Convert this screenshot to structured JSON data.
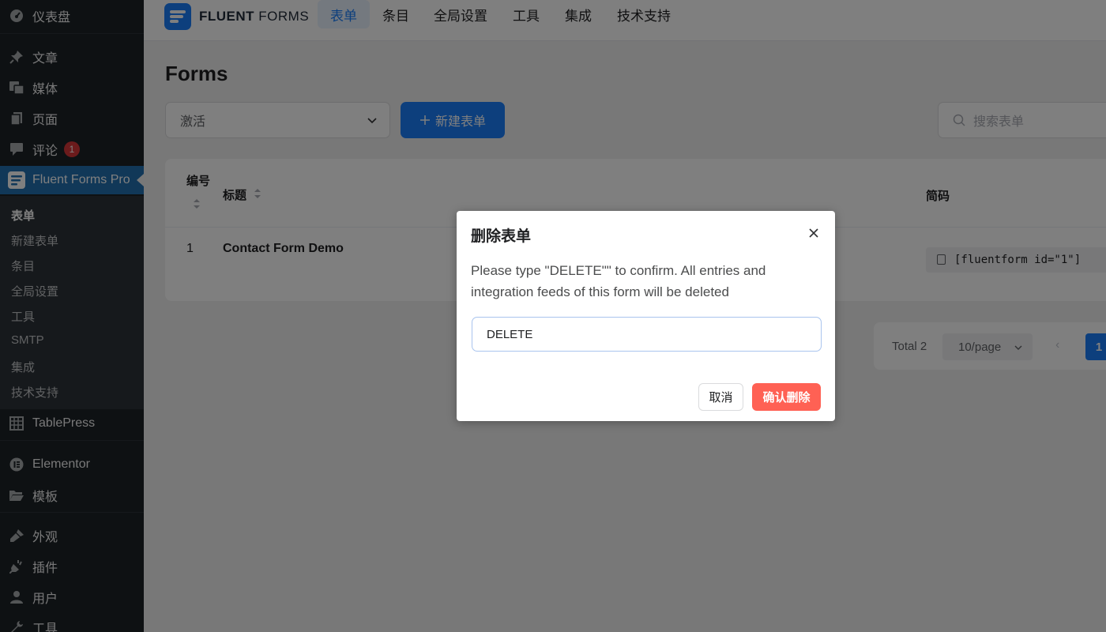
{
  "sidebar": {
    "items": [
      {
        "label": "仪表盘",
        "icon": "dashboard-icon"
      },
      {
        "label": "文章",
        "icon": "pin-icon"
      },
      {
        "label": "媒体",
        "icon": "media-icon"
      },
      {
        "label": "页面",
        "icon": "page-icon"
      },
      {
        "label": "评论",
        "icon": "comment-icon",
        "badge": "1"
      },
      {
        "label": "Fluent Forms Pro",
        "icon": "fluent-forms-icon"
      },
      {
        "label": "TablePress",
        "icon": "table-icon"
      },
      {
        "label": "Elementor",
        "icon": "elementor-icon"
      },
      {
        "label": "模板",
        "icon": "folder-icon"
      },
      {
        "label": "外观",
        "icon": "brush-icon"
      },
      {
        "label": "插件",
        "icon": "plugin-icon"
      },
      {
        "label": "用户",
        "icon": "user-icon"
      },
      {
        "label": "工具",
        "icon": "wrench-icon"
      }
    ],
    "submenu": [
      "表单",
      "新建表单",
      "条目",
      "全局设置",
      "工具",
      "SMTP",
      "集成",
      "技术支持"
    ]
  },
  "topbar": {
    "brand_bold": "FLUENT",
    "brand_light": " FORMS",
    "tabs": [
      "表单",
      "条目",
      "全局设置",
      "工具",
      "集成",
      "技术支持"
    ]
  },
  "main": {
    "title": "Forms",
    "status_filter": "激活",
    "new_form_label": "新建表单",
    "search_placeholder": "搜索表单"
  },
  "table": {
    "headers": {
      "id": "编号",
      "title": "标题",
      "shortcode": "简码"
    },
    "rows": [
      {
        "id": "1",
        "title": "Contact Form Demo",
        "shortcode": "[fluentform id=\"1\"]"
      }
    ]
  },
  "pagination": {
    "total": "Total 2",
    "page_size": "10/page",
    "current_page": "1"
  },
  "dialog": {
    "title": "删除表单",
    "message": "Please type \"DELETE\"\" to confirm. All entries and integration feeds of this form will be deleted",
    "input_value": "DELETE",
    "cancel_label": "取消",
    "confirm_label": "确认删除"
  },
  "colors": {
    "accent": "#1a7efb",
    "danger": "#ff6154",
    "sidebar_bg": "#1d2327",
    "sidebar_active": "#2271b1"
  }
}
